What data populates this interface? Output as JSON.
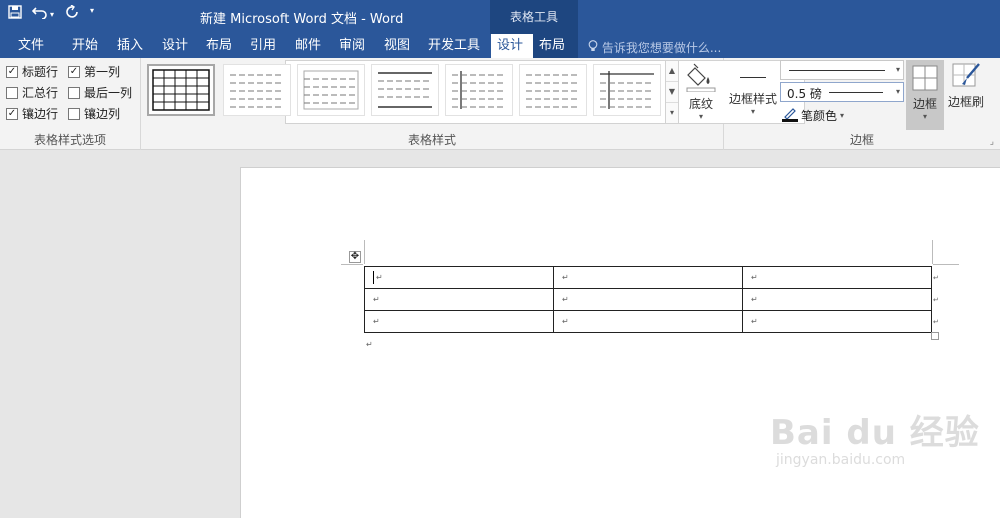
{
  "window": {
    "title": "新建 Microsoft Word 文档 - Word",
    "context_group": "表格工具",
    "quick_access": [
      "save-icon",
      "undo-icon",
      "redo-icon",
      "customize-icon"
    ]
  },
  "tabs": [
    {
      "label": "文件"
    },
    {
      "label": "开始"
    },
    {
      "label": "插入"
    },
    {
      "label": "设计"
    },
    {
      "label": "布局"
    },
    {
      "label": "引用"
    },
    {
      "label": "邮件"
    },
    {
      "label": "审阅"
    },
    {
      "label": "视图"
    },
    {
      "label": "开发工具"
    },
    {
      "label": "设计",
      "active": true
    },
    {
      "label": "布局"
    }
  ],
  "tell_me": "告诉我您想要做什么...",
  "ribbon": {
    "options": {
      "label": "表格样式选项",
      "items": [
        {
          "label": "标题行",
          "checked": true
        },
        {
          "label": "第一列",
          "checked": true
        },
        {
          "label": "汇总行",
          "checked": false
        },
        {
          "label": "最后一列",
          "checked": false
        },
        {
          "label": "镶边行",
          "checked": true
        },
        {
          "label": "镶边列",
          "checked": false
        }
      ]
    },
    "styles": {
      "label": "表格样式",
      "shading": "底纹"
    },
    "borders": {
      "label": "边框",
      "border_styles": "边框样式",
      "weight": "0.5 磅",
      "pen_color": "笔颜色",
      "border_button": "边框",
      "border_painter": "边框刷"
    }
  },
  "document": {
    "paragraph_mark": "↵"
  },
  "watermark": {
    "brand": "Bai du 经验",
    "url": "jingyan.baidu.com"
  },
  "colors": {
    "accent": "#2b579a",
    "context": "#1e4680"
  }
}
